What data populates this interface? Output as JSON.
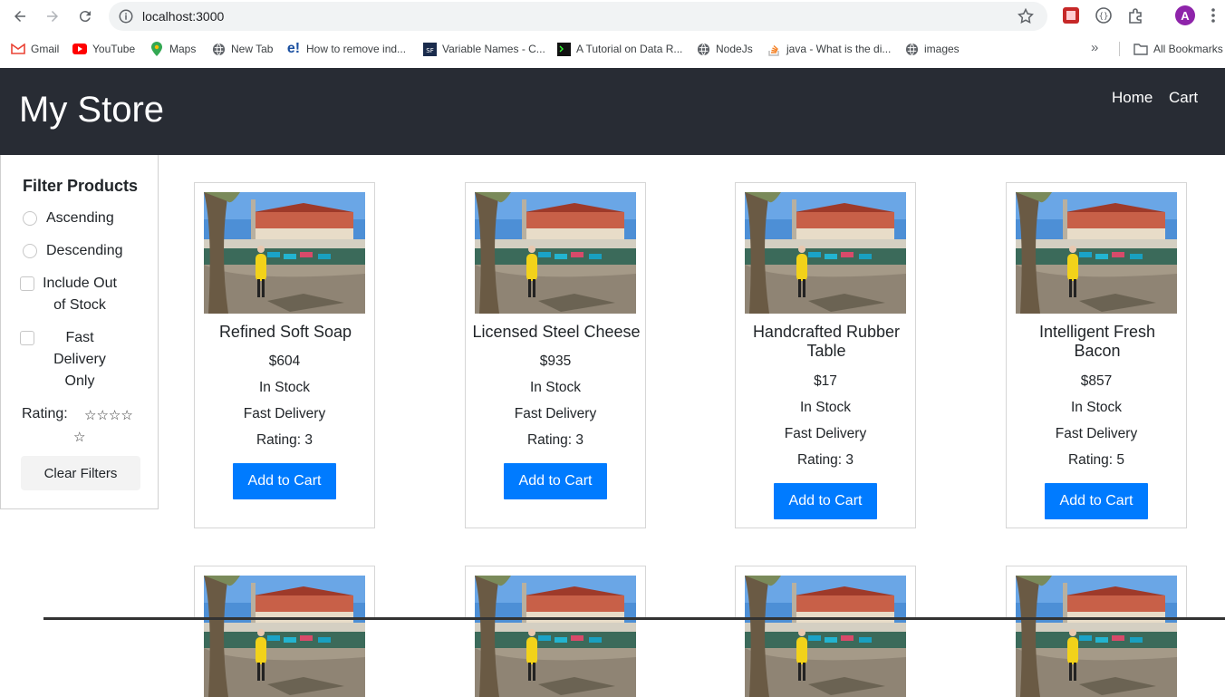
{
  "browser": {
    "url": "localhost:3000",
    "avatar_letter": "A",
    "bookmarks": [
      {
        "label": "Gmail",
        "icon": "gmail-icon"
      },
      {
        "label": "YouTube",
        "icon": "youtube-icon"
      },
      {
        "label": "Maps",
        "icon": "maps-icon"
      },
      {
        "label": "New Tab",
        "icon": "globe-icon"
      },
      {
        "label": "How to remove ind...",
        "icon": "e-icon"
      },
      {
        "label": "Variable Names - C...",
        "icon": "sf-icon"
      },
      {
        "label": "A Tutorial on Data R...",
        "icon": "terminal-icon"
      },
      {
        "label": "NodeJs",
        "icon": "globe-icon"
      },
      {
        "label": "java - What is the di...",
        "icon": "stackoverflow-icon"
      },
      {
        "label": "images",
        "icon": "globe-icon"
      }
    ],
    "all_bookmarks": "All Bookmarks",
    "more": "»"
  },
  "header": {
    "brand": "My Store",
    "nav": [
      "Home",
      "Cart"
    ]
  },
  "sidebar": {
    "title": "Filter Products",
    "ascending": "Ascending",
    "descending": "Descending",
    "include_out_1": "Include Out",
    "include_out_2": "of Stock",
    "fast_1": "Fast",
    "fast_2": "Delivery",
    "fast_3": "Only",
    "rating_label": "Rating:",
    "stars_row1": "☆☆☆☆",
    "stars_row2": "☆",
    "clear": "Clear Filters"
  },
  "products": [
    {
      "name_1": "Refined Soft Soap",
      "name_2": "",
      "price": "$604",
      "stock": "In Stock",
      "delivery": "Fast Delivery",
      "rating": "Rating: 3",
      "button": "Add to Cart"
    },
    {
      "name_1": "Licensed Steel Cheese",
      "name_2": "",
      "price": "$935",
      "stock": "In Stock",
      "delivery": "Fast Delivery",
      "rating": "Rating: 3",
      "button": "Add to Cart"
    },
    {
      "name_1": "Handcrafted Rubber",
      "name_2": "Table",
      "price": "$17",
      "stock": "In Stock",
      "delivery": "Fast Delivery",
      "rating": "Rating: 3",
      "button": "Add to Cart"
    },
    {
      "name_1": "Intelligent Fresh",
      "name_2": "Bacon",
      "price": "$857",
      "stock": "In Stock",
      "delivery": "Fast Delivery",
      "rating": "Rating: 5",
      "button": "Add to Cart"
    }
  ],
  "colors": {
    "header_bg": "#282c34",
    "button_blue": "#007bff"
  }
}
